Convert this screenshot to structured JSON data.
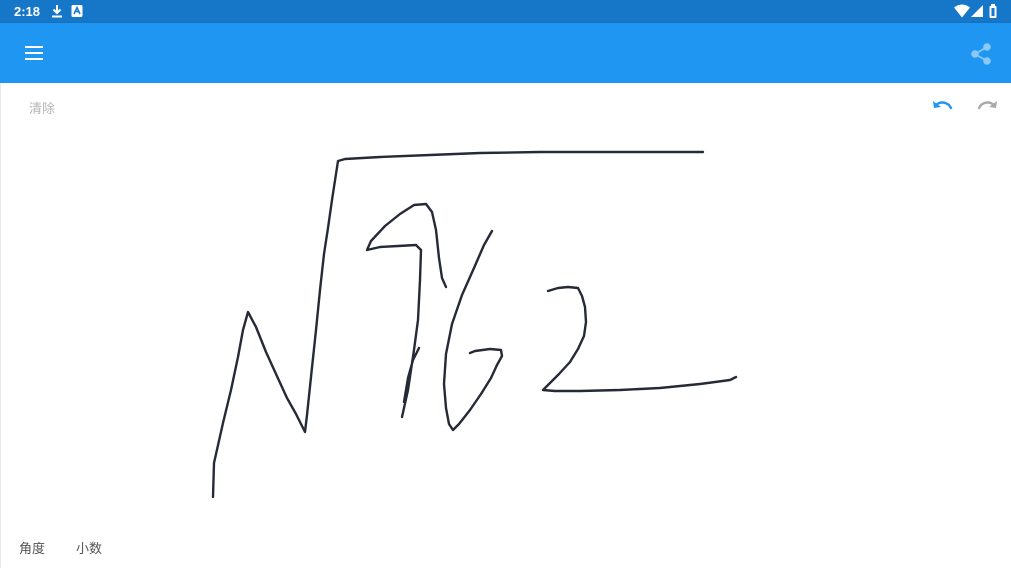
{
  "status_bar": {
    "time": "2:18",
    "left_icons": [
      "download-icon",
      "app-notification-icon"
    ],
    "right_icons": [
      "wifi-icon",
      "signal-icon",
      "battery-icon"
    ],
    "background_color": "#1677c9"
  },
  "app_bar": {
    "background_color": "#1f97f2",
    "menu_icon": "menu-icon",
    "share_icon": "share-icon"
  },
  "canvas": {
    "clear_label": "清除",
    "undo_icon": "undo-icon",
    "redo_icon": "redo-icon",
    "ink_color": "#252a36",
    "accent_color": "#1f97f2"
  },
  "bottom_bar": {
    "angle_label": "角度",
    "decimal_label": "小数"
  }
}
